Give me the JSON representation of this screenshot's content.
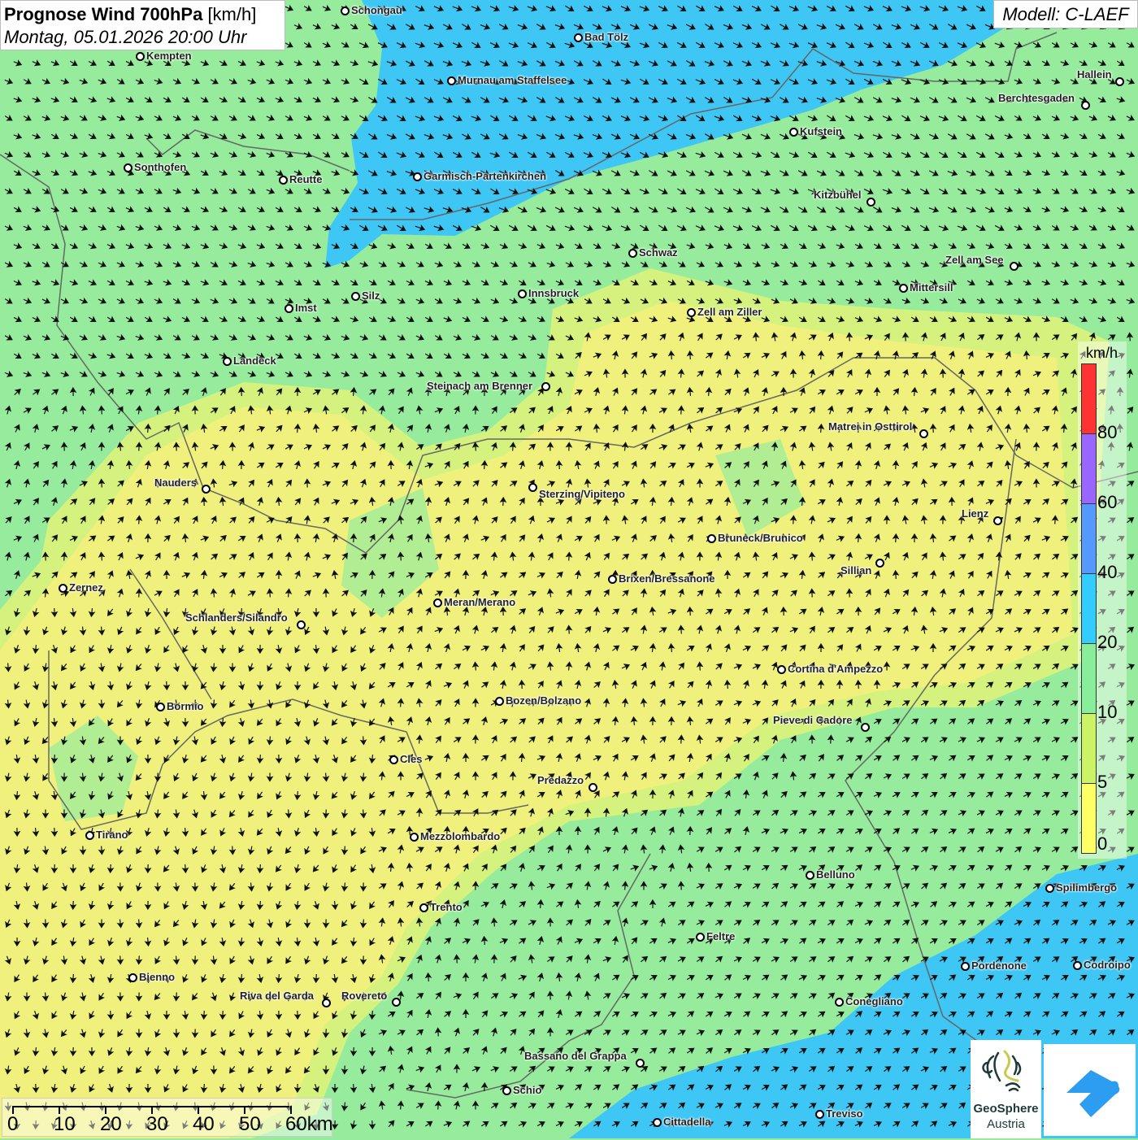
{
  "header": {
    "title_bold": "Prognose Wind 700hPa",
    "title_unit": "[km/h]",
    "datetime": "Montag, 05.01.2026 20:00 Uhr",
    "model": "Modell: C-LAEF"
  },
  "colors": {
    "zone_0_5": "#f4f07c",
    "zone_5_10": "#d6f27e",
    "zone_10_20": "#96ec9c",
    "zone_20_40": "#3ec6f4",
    "border": "#666666"
  },
  "legend": {
    "unit": "km/h",
    "labels": [
      "80",
      "60",
      "40",
      "20",
      "10",
      "5",
      "0"
    ],
    "colors": [
      "#ff3333",
      "#9966ff",
      "#5599ff",
      "#33ccff",
      "#88ee99",
      "#ccf266",
      "#ffff66"
    ]
  },
  "scale": {
    "labels": [
      "0",
      "10",
      "20",
      "30",
      "40",
      "50",
      "60km"
    ]
  },
  "cities": [
    "Schongau",
    "Bad Tölz",
    "Kempten",
    "Murnau am Staffelsee",
    "Hallein",
    "Berchtesgaden",
    "Kufstein",
    "Sonthofen",
    "Reutte",
    "Garmisch-Partenkirchen",
    "Kitzbühel",
    "Schwaz",
    "Zell am See",
    "Mittersill",
    "Innsbruck",
    "Silz",
    "Imst",
    "Zell am Ziller",
    "Landeck",
    "Steinach am Brenner",
    "Matrei in Osttirol",
    "Nauders",
    "Sterzing/Vipiteno",
    "Lienz",
    "Bruneck/Brunico",
    "Sillian",
    "Brixen/Bressanone",
    "Zernez",
    "Meran/Merano",
    "Schlanders/Silandro",
    "Cortina d'Ampezzo",
    "Bozen/Bolzano",
    "Bormio",
    "Pieve di Cadore",
    "Cles",
    "Predazzo",
    "Tirano",
    "Mezzolombardo",
    "Belluno",
    "Spilimbergo",
    "Trento",
    "Feltre",
    "Pordenone",
    "Codroipo",
    "Bienno",
    "Riva del Garda",
    "Rovereto",
    "Conegliano",
    "Bassano del Grappa",
    "Schio",
    "Treviso",
    "Cittadella"
  ],
  "logos": {
    "geosphere_line1": "GeoSphere",
    "geosphere_line2": "Austria"
  }
}
